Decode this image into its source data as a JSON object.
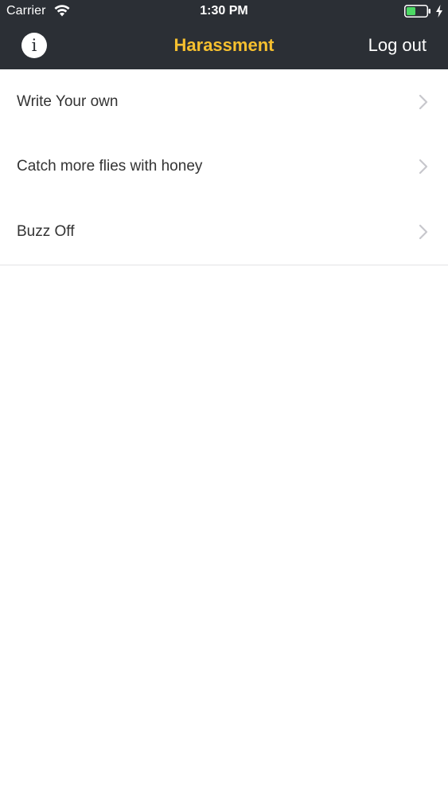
{
  "status_bar": {
    "carrier": "Carrier",
    "time": "1:30 PM",
    "icons": [
      "wifi-icon",
      "battery-icon",
      "charging-bolt-icon"
    ],
    "battery_color": "#4cd964"
  },
  "nav": {
    "info_label": "i",
    "title": "Harassment",
    "logout_label": "Log out",
    "title_color": "#f6c02f",
    "background_color": "#2b2f35"
  },
  "list": {
    "items": [
      {
        "label": "Write Your own"
      },
      {
        "label": "Catch more flies with honey"
      },
      {
        "label": "Buzz Off"
      }
    ]
  }
}
